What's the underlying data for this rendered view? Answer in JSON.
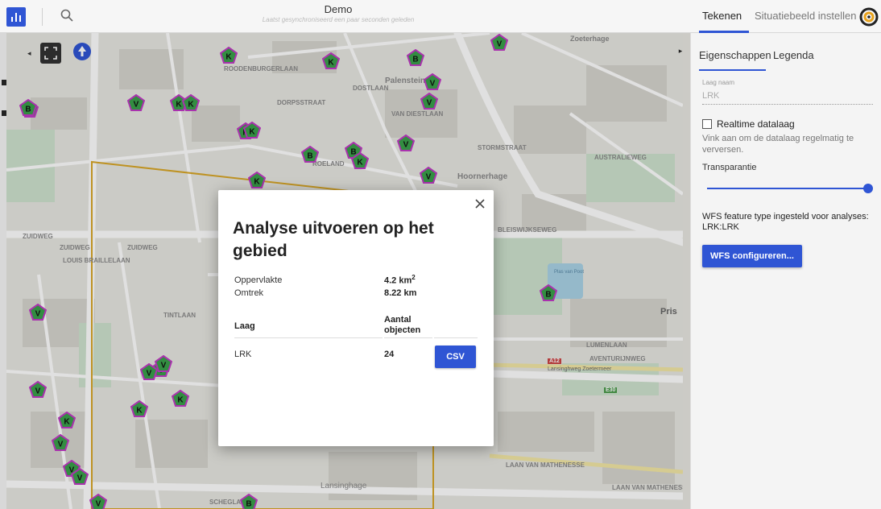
{
  "header": {
    "title": "Demo",
    "subtitle": "Laatst gesynchroniseerd een paar seconden geleden",
    "tabs": [
      {
        "label": "Tekenen",
        "active": true
      },
      {
        "label": "Situatiebeeld instellen",
        "active": false
      }
    ],
    "icons": {
      "chart": "bar-chart-icon",
      "search": "search-icon",
      "logo": "app-logo-icon"
    }
  },
  "map": {
    "labels": [
      {
        "text": "Zoeterhage"
      },
      {
        "text": "Palenstein"
      },
      {
        "text": "VAN DIESTLAAN"
      },
      {
        "text": "Hoornerhage"
      },
      {
        "text": "ZUIDWEG"
      },
      {
        "text": "ZUIDWEG"
      },
      {
        "text": "ZUIDWEG"
      },
      {
        "text": "LOUIS BRAILLELAAN"
      },
      {
        "text": "TINTLAAN"
      },
      {
        "text": "DORPSSTRAAT"
      },
      {
        "text": "DOSTLAAN"
      },
      {
        "text": "ROELAND"
      },
      {
        "text": "STORMSTRAAT"
      },
      {
        "text": "ROODENBURGERLAAN"
      },
      {
        "text": "LUMENLAAN"
      },
      {
        "text": "AVENTURIJNWEG"
      },
      {
        "text": "LAAN VAN MATHENESSE"
      },
      {
        "text": "LAAN VAN MATHENESSE"
      },
      {
        "text": "Lansinghage"
      },
      {
        "text": "SCHEGLAAN"
      },
      {
        "text": "Pris"
      },
      {
        "text": "Lansinghweg Zoetermeer"
      },
      {
        "text": "A12"
      },
      {
        "text": "E30"
      },
      {
        "text": "BLEISWIJKSEWEG"
      },
      {
        "text": "AUSTRALIEWEG"
      },
      {
        "text": "Plas van Poot"
      }
    ],
    "markers": [
      {
        "letter": "K"
      },
      {
        "letter": "K"
      },
      {
        "letter": "B"
      },
      {
        "letter": "V"
      },
      {
        "letter": "K"
      },
      {
        "letter": "V"
      },
      {
        "letter": "K"
      },
      {
        "letter": "K"
      },
      {
        "letter": "V"
      },
      {
        "letter": "V"
      },
      {
        "letter": "K"
      },
      {
        "letter": "B"
      },
      {
        "letter": "B"
      },
      {
        "letter": "K"
      },
      {
        "letter": "K"
      },
      {
        "letter": "V"
      },
      {
        "letter": "V"
      },
      {
        "letter": "K"
      },
      {
        "letter": "B"
      },
      {
        "letter": "V"
      },
      {
        "letter": "V"
      },
      {
        "letter": "V"
      },
      {
        "letter": "V"
      },
      {
        "letter": "K"
      },
      {
        "letter": "K"
      },
      {
        "letter": "K"
      },
      {
        "letter": "V"
      },
      {
        "letter": "V"
      },
      {
        "letter": "B"
      },
      {
        "letter": "V"
      },
      {
        "letter": "B"
      },
      {
        "letter": "V"
      },
      {
        "letter": "V"
      }
    ],
    "controls": {
      "collapse": "◂",
      "fullscreen": "fullscreen-icon",
      "north": "north-arrow-icon"
    }
  },
  "panel": {
    "toggle": "▸",
    "tabs": [
      {
        "label": "Eigenschappen",
        "active": true
      },
      {
        "label": "Legenda",
        "active": false
      }
    ],
    "layer_name_label": "Laag naam",
    "layer_name_value": "LRK",
    "realtime_label": "Realtime datalaag",
    "realtime_checked": false,
    "realtime_help": "Vink aan om de datalaag regelmatig te verversen.",
    "transparency_label": "Transparantie",
    "transparency_value": 1.0,
    "wfs_text": "WFS feature type ingesteld voor analyses: LRK:LRK",
    "wfs_button": "WFS configureren..."
  },
  "modal": {
    "title": "Analyse uitvoeren op het gebied",
    "stats": [
      {
        "label": "Oppervlakte",
        "value": "4.2 km",
        "sup": "2"
      },
      {
        "label": "Omtrek",
        "value": "8.22 km",
        "sup": ""
      }
    ],
    "table": {
      "headers": [
        "Laag",
        "Aantal objecten"
      ],
      "rows": [
        {
          "layer": "LRK",
          "count": "24",
          "action": "CSV"
        }
      ]
    },
    "close": "close-icon"
  },
  "colors": {
    "accent": "#2f55d4",
    "marker_fill": "#3aa14a",
    "marker_border": "#c23ac6",
    "area_outline": "#d9a727"
  }
}
